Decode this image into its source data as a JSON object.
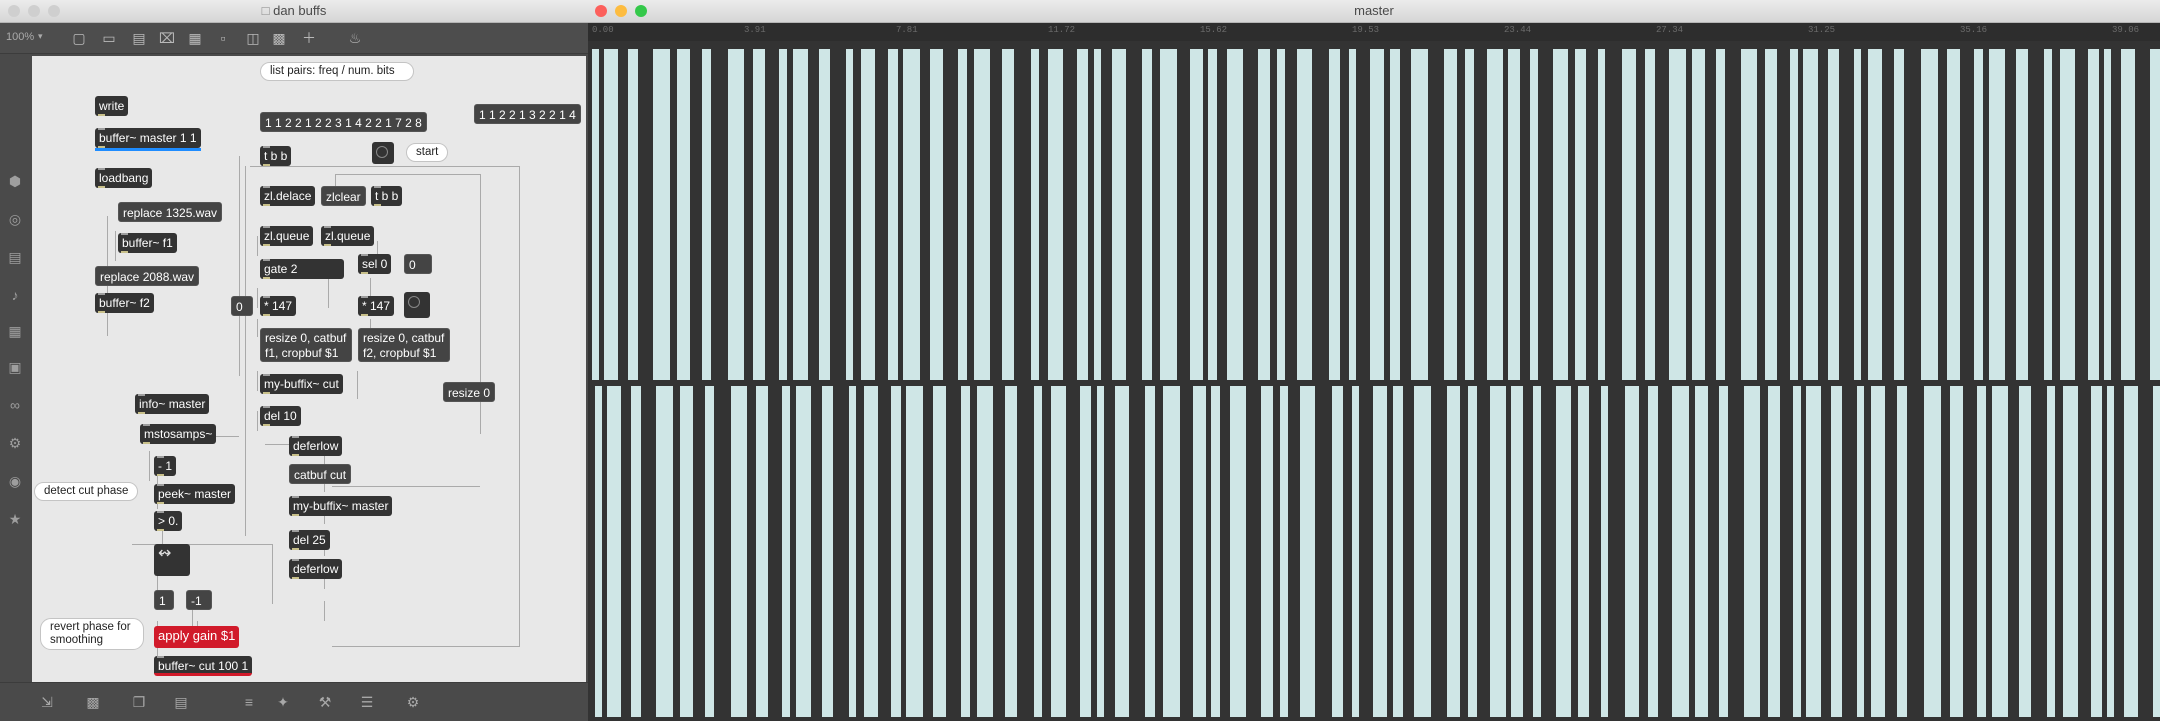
{
  "patcher": {
    "title": "dan buffs",
    "zoom": "100%",
    "toolbar_icons": [
      "lock-icon",
      "presentation-icon",
      "grid-icon",
      "comment-icon",
      "clear-icon",
      "save-icon",
      "inspector-icon",
      "format-icon",
      "snap-icon",
      "add-icon",
      "paint-icon"
    ],
    "sidebar_icons": [
      "cube-icon",
      "target-icon",
      "film-icon",
      "note-icon",
      "device-icon",
      "image-icon",
      "link-icon",
      "gear-icon",
      "plugin-icon",
      "star-icon"
    ],
    "bottom_icons": [
      "split-icon",
      "message-icon",
      "window-icon",
      "package-icon",
      "sliders-icon",
      "magic-icon",
      "wrench-icon",
      "library-icon",
      "settings-icon"
    ],
    "objects": {
      "write": "write",
      "buffer_master": "buffer~ master 1 1",
      "loadbang": "loadbang",
      "replace_1325": "replace 1325.wav",
      "buffer_f1": "buffer~ f1",
      "replace_2088": "replace 2088.wav",
      "buffer_f2": "buffer~ f2",
      "list_msg_1": "1 1 2 2 1 2 2 3 1 4 2 2 1 7 2 8",
      "list_msg_2": "1 1 2 2 1 3 2 2 1 4",
      "tbb_1": "t b b",
      "start": "start",
      "zl_delace": "zl.delace",
      "zlclear": "zlclear",
      "tbb_2": "t b b",
      "zl_queue_1": "zl.queue",
      "zl_queue_2": "zl.queue",
      "gate": "gate 2",
      "sel0": "sel 0",
      "zero_msg_1": "0",
      "zero_msg_2": "0",
      "mult147_1": "* 147",
      "mult147_2": "* 147",
      "resize_f1": "resize 0, catbuf f1, cropbuf $1",
      "resize_f2": "resize 0, catbuf f2, cropbuf $1",
      "my_buffix_cut": "my-buffix~ cut",
      "resize0": "resize 0",
      "del10": "del 10",
      "deferlow_1": "deferlow",
      "catbuf_cut": "catbuf cut",
      "my_buffix_master": "my-buffix~ master",
      "del25": "del 25",
      "deferlow_2": "deferlow",
      "info_master": "info~ master",
      "mstosamps": "mstosamps~",
      "minus1_obj": "- 1",
      "peek_master": "peek~ master",
      "gt0": "> 0.",
      "one_msg": "1",
      "neg_one_msg": "-1",
      "apply_gain": "apply gain $1",
      "buffer_cut": "buffer~ cut 100 1"
    },
    "comments": {
      "list_pairs": "list pairs: freq / num. bits",
      "detect_cut": "detect cut phase",
      "revert_phase": "revert phase for smoothing"
    }
  },
  "buffer_view": {
    "title": "master",
    "ruler_ticks": [
      "0.00",
      "3.91",
      "7.81",
      "11.72",
      "15.62",
      "19.53",
      "23.44",
      "27.34",
      "31.25",
      "35.16",
      "39.06"
    ],
    "waveform_color": "#cfe6e6",
    "background_color": "#333333"
  }
}
